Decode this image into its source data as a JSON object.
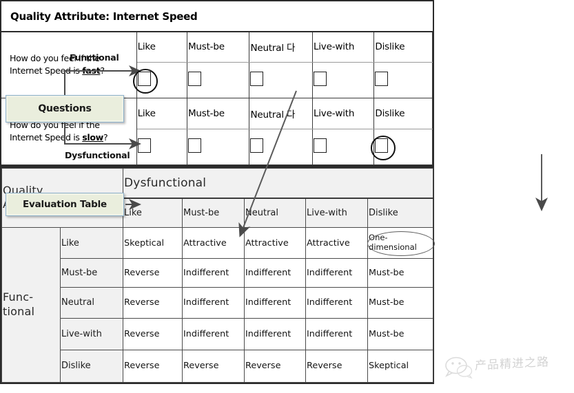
{
  "diagram": {
    "callouts": [
      {
        "id": "questions",
        "label": "Questions"
      },
      {
        "id": "evaluation-table",
        "label": "Evaluation Table"
      }
    ],
    "branch_labels": {
      "functional": "Functional",
      "dysfunctional": "Dysfunctional"
    },
    "accent_box_fill": "#eaeedd",
    "accent_box_border": "#8fb3d0",
    "header_fill": "#f1f1f1",
    "line_color": "#3c3c3c"
  },
  "questionnaire": {
    "title": "Quality Attribute: Internet Speed",
    "options": [
      "Like",
      "Must-be",
      "Neutral 다",
      "Live-with",
      "Dislike"
    ],
    "rows": [
      {
        "question_prefix": "How do you feel if the",
        "question_line2_pre": "Internet Speed is ",
        "question_emphasis": "fast",
        "question_line2_post": "?",
        "selected_option": "Like",
        "selected_index": 0
      },
      {
        "question_prefix": "How do you feel if the",
        "question_line2_pre": "Internet Speed is ",
        "question_emphasis": "slow",
        "question_line2_post": "?",
        "selected_option": "Dislike",
        "selected_index": 4
      }
    ]
  },
  "evaluation_table": {
    "corner_label_line1": "Quality",
    "corner_label_line2": "Attribute",
    "column_group_label": "Dysfunctional",
    "row_group_label_line1": "Func-",
    "row_group_label_line2": "tional",
    "columns": [
      "Like",
      "Must-be",
      "Neutral",
      "Live-with",
      "Dislike"
    ],
    "rows": [
      "Like",
      "Must-be",
      "Neutral",
      "Live-with",
      "Dislike"
    ],
    "matrix": [
      [
        "Skeptical",
        "Attractive",
        "Attractive",
        "Attractive",
        "One-dimensional"
      ],
      [
        "Reverse",
        "Indifferent",
        "Indifferent",
        "Indifferent",
        "Must-be"
      ],
      [
        "Reverse",
        "Indifferent",
        "Indifferent",
        "Indifferent",
        "Must-be"
      ],
      [
        "Reverse",
        "Indifferent",
        "Indifferent",
        "Indifferent",
        "Must-be"
      ],
      [
        "Reverse",
        "Reverse",
        "Reverse",
        "Reverse",
        "Skeptical"
      ]
    ],
    "highlighted_cell": {
      "row": 0,
      "col": 4,
      "value": "One-dimensional"
    }
  },
  "watermark": {
    "text": "产品精进之路"
  }
}
